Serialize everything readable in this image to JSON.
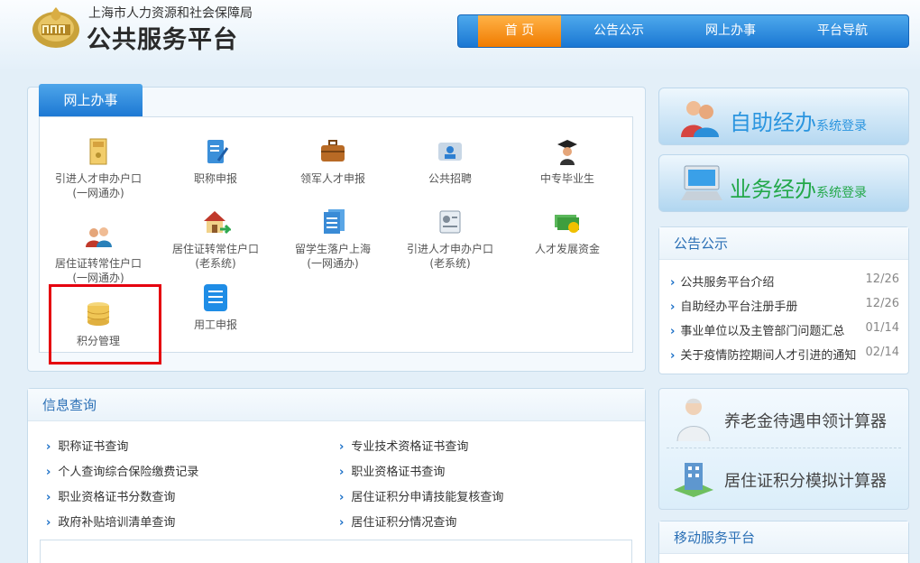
{
  "header": {
    "org_name": "上海市人力资源和社会保障局",
    "platform_title": "公共服务平台",
    "nav": [
      "首 页",
      "公告公示",
      "网上办事",
      "平台导航"
    ]
  },
  "services": {
    "tab": "网上办事",
    "items": [
      {
        "l1": "引进人才申办户口",
        "l2": "(一网通办)",
        "icon": "envelope-file-icon"
      },
      {
        "l1": "职称申报",
        "l2": "",
        "icon": "edit-document-icon"
      },
      {
        "l1": "领军人才申报",
        "l2": "",
        "icon": "briefcase-icon"
      },
      {
        "l1": "公共招聘",
        "l2": "",
        "icon": "recruitment-icon"
      },
      {
        "l1": "中专毕业生",
        "l2": "",
        "icon": "graduate-icon"
      },
      {
        "l1": "居住证转常住户口",
        "l2": "(一网通办)",
        "icon": "users-icon"
      },
      {
        "l1": "居住证转常住户口",
        "l2": "(老系统)",
        "icon": "house-arrow-icon"
      },
      {
        "l1": "留学生落户上海",
        "l2": "(一网通办)",
        "icon": "documents-stack-icon"
      },
      {
        "l1": "引进人才申办户口",
        "l2": "(老系统)",
        "icon": "id-card-icon"
      },
      {
        "l1": "人才发展资金",
        "l2": "",
        "icon": "money-icon"
      },
      {
        "l1": "积分管理",
        "l2": "",
        "icon": "database-icon"
      },
      {
        "l1": "用工申报",
        "l2": "",
        "icon": "list-document-icon"
      }
    ]
  },
  "info": {
    "title": "信息查询",
    "left": [
      "职称证书查询",
      "个人查询综合保险缴费记录",
      "职业资格证书分数查询",
      "政府补贴培训清单查询"
    ],
    "right": [
      "专业技术资格证书查询",
      "职业资格证书查询",
      "居住证积分申请技能复核查询",
      "居住证积分情况查询"
    ]
  },
  "banners": {
    "self": "自助经办",
    "self_suffix": "系统登录",
    "biz": "业务经办",
    "biz_suffix": "系统登录"
  },
  "notice": {
    "title": "公告公示",
    "items": [
      {
        "t": "公共服务平台介绍",
        "d": "12/26"
      },
      {
        "t": "自助经办平台注册手册",
        "d": "12/26"
      },
      {
        "t": "事业单位以及主管部门问题汇总",
        "d": "01/14"
      },
      {
        "t": "关于疫情防控期间人才引进的通知",
        "d": "02/14"
      }
    ]
  },
  "calculators": [
    "养老金待遇申领计算器",
    "居住证积分模拟计算器"
  ],
  "mobile": {
    "title": "移动服务平台"
  },
  "colors": {
    "accent": "#1d78d3",
    "active_nav": "#f07b00",
    "highlight": "#e5000f"
  }
}
